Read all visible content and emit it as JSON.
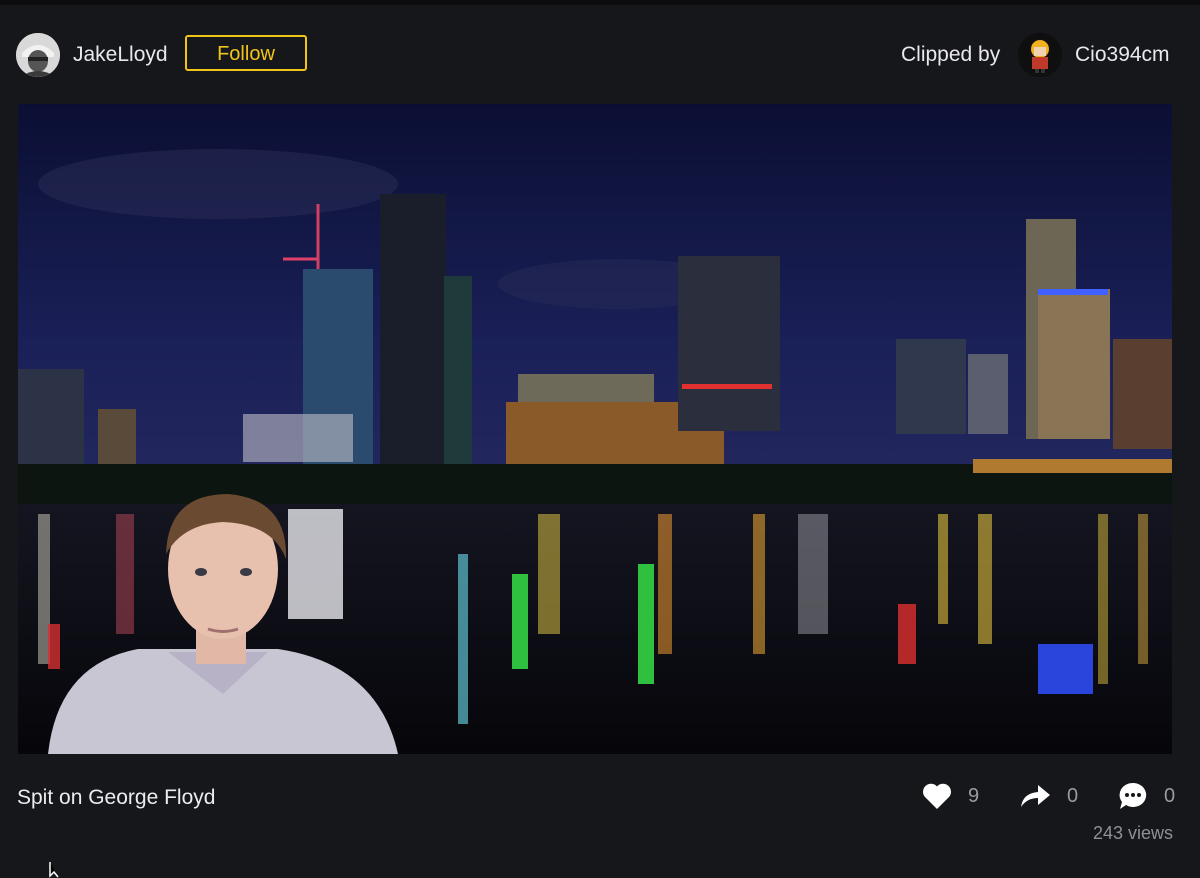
{
  "header": {
    "username": "JakeLloyd",
    "follow_label": "Follow",
    "clipped_by_label": "Clipped by",
    "clipper_name": "Cio394cm"
  },
  "clip": {
    "title": "Spit on George Floyd",
    "likes": "9",
    "shares": "0",
    "comments": "0",
    "views": "243 views"
  },
  "icons": {
    "like": "heart-icon",
    "share": "share-arrow-icon",
    "comment": "comment-bubble-icon"
  },
  "colors": {
    "background": "#16171b",
    "accent": "#f0c419",
    "text": "#e8e8ea",
    "muted": "#9a9aa0"
  }
}
